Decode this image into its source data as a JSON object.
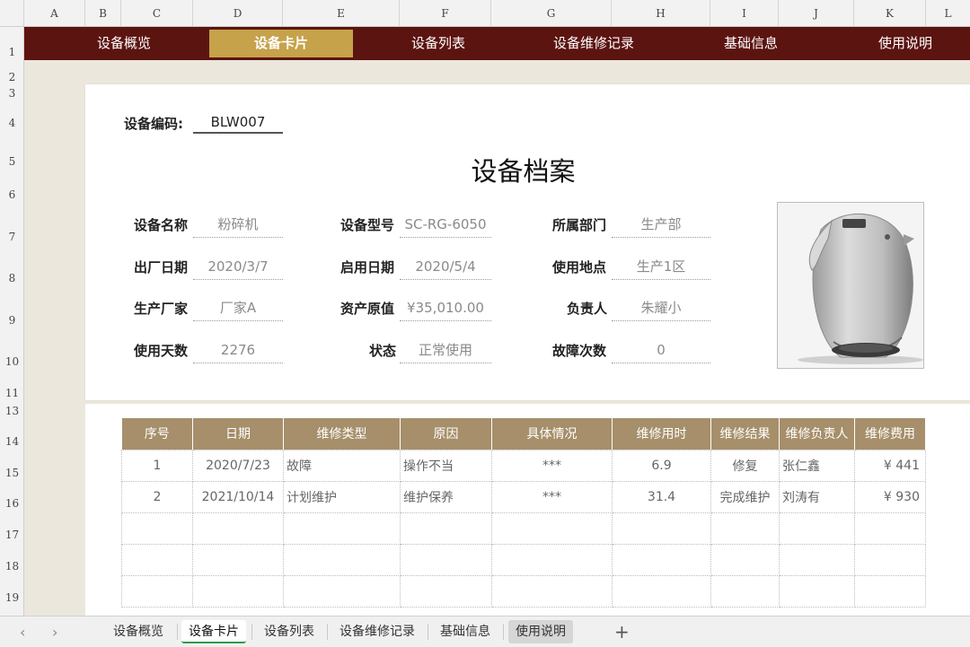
{
  "columns": [
    "A",
    "B",
    "C",
    "D",
    "E",
    "F",
    "G",
    "H",
    "I",
    "J",
    "K",
    "L"
  ],
  "rows": [
    "1",
    "2",
    "3",
    "4",
    "5",
    "6",
    "7",
    "8",
    "9",
    "10",
    "11",
    "13",
    "14",
    "15",
    "16",
    "17",
    "18",
    "19"
  ],
  "nav": [
    "设备概览",
    "设备卡片",
    "设备列表",
    "设备维修记录",
    "基础信息",
    "使用说明"
  ],
  "card": {
    "code_label": "设备编码:",
    "code_value": "BLW007",
    "title": "设备档案",
    "fields": [
      {
        "label": "设备名称",
        "value": "粉碎机"
      },
      {
        "label": "设备型号",
        "value": "SC-RG-6050"
      },
      {
        "label": "所属部门",
        "value": "生产部"
      },
      {
        "label": "出厂日期",
        "value": "2020/3/7"
      },
      {
        "label": "启用日期",
        "value": "2020/5/4"
      },
      {
        "label": "使用地点",
        "value": "生产1区"
      },
      {
        "label": "生产厂家",
        "value": "厂家A"
      },
      {
        "label": "资产原值",
        "value": "¥35,010.00"
      },
      {
        "label": "负责人",
        "value": "朱耀小"
      },
      {
        "label": "使用天数",
        "value": "2276"
      },
      {
        "label": "状态",
        "value": "正常使用"
      },
      {
        "label": "故障次数",
        "value": "0"
      }
    ]
  },
  "table": {
    "headers": [
      "序号",
      "日期",
      "维修类型",
      "原因",
      "具体情况",
      "维修用时",
      "维修结果",
      "维修负责人",
      "维修费用"
    ],
    "rows": [
      [
        "1",
        "2020/7/23",
        "故障",
        "操作不当",
        "***",
        "6.9",
        "修复",
        "张仁鑫",
        "¥ 441"
      ],
      [
        "2",
        "2021/10/14",
        "计划维护",
        "维护保养",
        "***",
        "31.4",
        "完成维护",
        "刘涛有",
        "¥ 930"
      ],
      [
        "",
        "",
        "",
        "",
        "",
        "",
        "",
        "",
        ""
      ],
      [
        "",
        "",
        "",
        "",
        "",
        "",
        "",
        "",
        ""
      ],
      [
        "",
        "",
        "",
        "",
        "",
        "",
        "",
        "",
        ""
      ]
    ]
  },
  "tabs": [
    "设备概览",
    "设备卡片",
    "设备列表",
    "设备维修记录",
    "基础信息",
    "使用说明"
  ],
  "tab_nav": {
    "prev": "‹",
    "next": "›",
    "add": "+"
  }
}
